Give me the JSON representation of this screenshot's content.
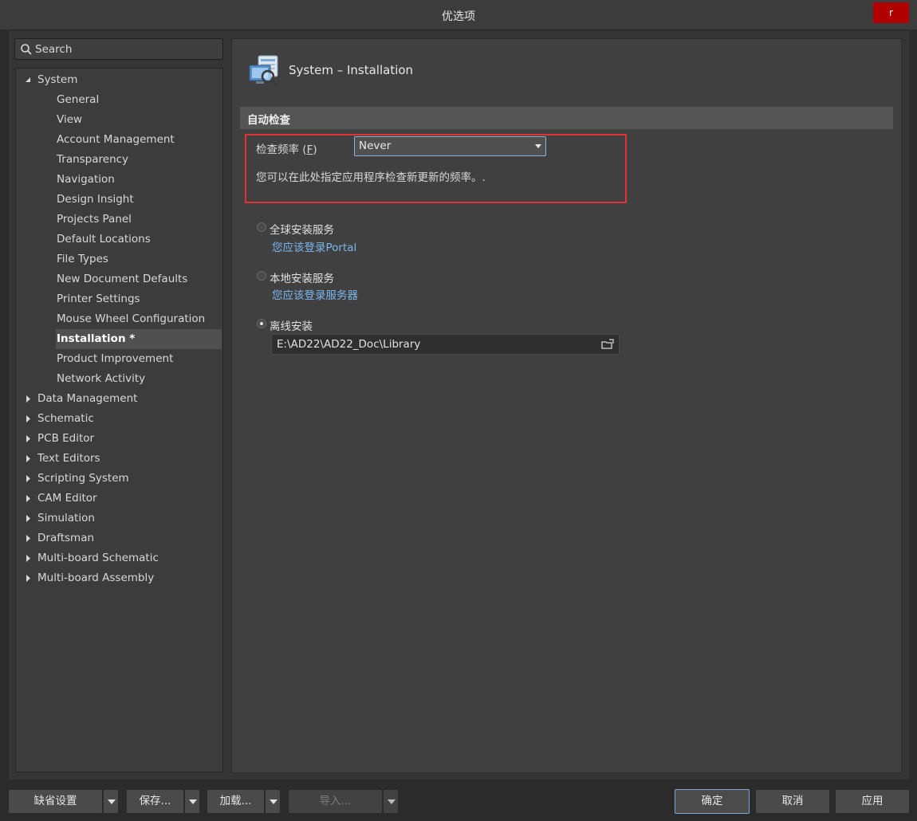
{
  "window": {
    "title": "优选项",
    "close_label": "r"
  },
  "search": {
    "placeholder": "Search"
  },
  "tree": {
    "system_label": "System",
    "system_children": [
      "General",
      "View",
      "Account Management",
      "Transparency",
      "Navigation",
      "Design Insight",
      "Projects Panel",
      "Default Locations",
      "File Types",
      "New Document Defaults",
      "Printer Settings",
      "Mouse Wheel Configuration",
      "Installation *",
      "Product Improvement",
      "Network Activity"
    ],
    "selected": "Installation *",
    "categories": [
      "Data Management",
      "Schematic",
      "PCB Editor",
      "Text Editors",
      "Scripting System",
      "CAM Editor",
      "Simulation",
      "Draftsman",
      "Multi-board Schematic",
      "Multi-board Assembly"
    ]
  },
  "page": {
    "title": "System – Installation",
    "section_title": "自动检查",
    "freq_label": "检查频率",
    "freq_hotkey": "F",
    "freq_value": "Never",
    "hint": "您可以在此处指定应用程序检查新更新的频率。.",
    "options": [
      {
        "label": "全球安装服务",
        "link": "您应该登录Portal",
        "checked": false
      },
      {
        "label": "本地安装服务",
        "link": "您应该登录服务器",
        "checked": false
      },
      {
        "label": "离线安装",
        "checked": true
      }
    ],
    "offline_path": "E:\\AD22\\AD22_Doc\\Library"
  },
  "buttons": {
    "defaults": "缺省设置",
    "save": "保存...",
    "load": "加载...",
    "import": "导入...",
    "ok": "确定",
    "cancel": "取消",
    "apply": "应用"
  },
  "colors": {
    "accent": "#79b7ee",
    "highlight": "#e03434",
    "close": "#b00000"
  }
}
